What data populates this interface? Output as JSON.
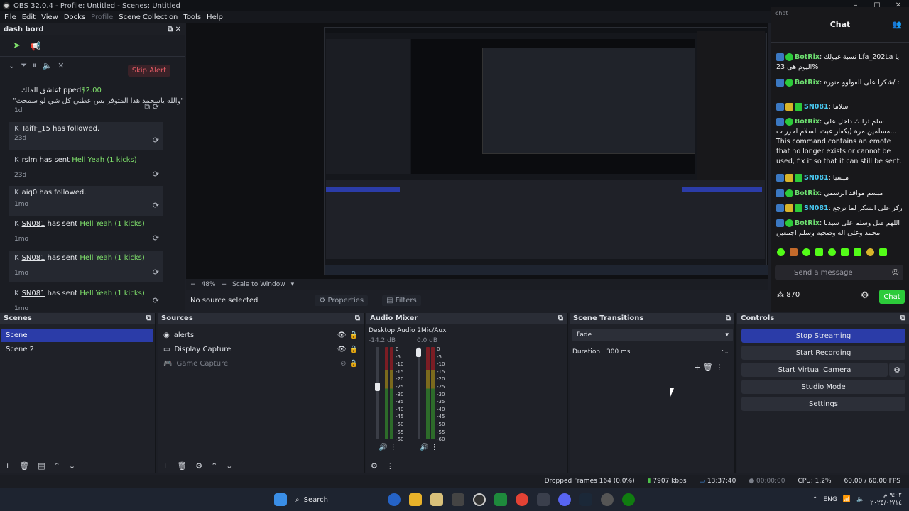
{
  "window": {
    "title": "OBS 32.0.4 - Profile: Untitled - Scenes: Untitled",
    "min": "–",
    "max": "□",
    "close": "✕"
  },
  "menu": [
    "File",
    "Edit",
    "View",
    "Docks",
    "Profile",
    "Scene Collection",
    "Tools",
    "Help"
  ],
  "dash": {
    "title": "dash bord",
    "skip": "Skip Alert",
    "events": [
      {
        "user": "عاشق الملك",
        "action": "tipped",
        "amount": "$2.00",
        "msg": "\"والله ياسحمد هذا المتوفر بس عطني كل شي لو سمحت\"",
        "time": "1d"
      },
      {
        "user": "TaifF_15",
        "action": "has followed.",
        "time": "23d"
      },
      {
        "user": "rslm",
        "action": "has sent",
        "gift": "Hell Yeah (1 kicks)",
        "time": "23d"
      },
      {
        "user": "aiq0",
        "action": "has followed.",
        "time": "1mo"
      },
      {
        "user": "SN081",
        "action": "has sent",
        "gift": "Hell Yeah (1 kicks)",
        "time": "1mo"
      },
      {
        "user": "SN081",
        "action": "has sent",
        "gift": "Hell Yeah (1 kicks)",
        "time": "1mo"
      },
      {
        "user": "SN081",
        "action": "has sent",
        "gift": "Hell Yeah (1 kicks)",
        "time": "1mo"
      }
    ]
  },
  "preview": {
    "zoom": "48%",
    "scale": "Scale to Window",
    "no_source": "No source selected",
    "properties": "Properties",
    "filters": "Filters"
  },
  "chat": {
    "small": "chat",
    "title": "Chat",
    "input_placeholder": "Send a message",
    "viewers": "870",
    "send": "Chat",
    "messages": [
      {
        "user": "BotRix",
        "text": "نسبة غيولك Lfa_202La يا %اليوم هي 23"
      },
      {
        "user": "BotRix",
        "text": "شكرا على الفولوو منورة/ :"
      },
      {
        "user": "SN081",
        "text": "سلاما"
      },
      {
        "user": "BotRix",
        "text": "سلم ثرالك داخل على مسلمين مرة (يكفار عبث السلام احرر ت... This command contains an emote that no longer exists or cannot be used, fix it so that it can still be sent."
      },
      {
        "user": "SN081",
        "text": "ميسيا"
      },
      {
        "user": "BotRix",
        "text": "مبسم مواقد الرسمي"
      },
      {
        "user": "SN081",
        "text": "ركز على الشكر لما ترجع"
      },
      {
        "user": "BotRix",
        "text": "اللهم صل وسلم على سيدنا محمد وعلى اله وصحبه وسلم اجمعين"
      }
    ]
  },
  "scenes": {
    "title": "Scenes",
    "items": [
      "Scene",
      "Scene 2"
    ]
  },
  "sources": {
    "title": "Sources",
    "items": [
      "alerts",
      "Display Capture",
      "Game Capture"
    ]
  },
  "mixer": {
    "title": "Audio Mixer",
    "channels": [
      {
        "name": "Desktop Audio 2",
        "db": "-14.2 dB"
      },
      {
        "name": "Mic/Aux",
        "db": "0.0 dB"
      }
    ],
    "scale": [
      "0",
      "-5",
      "-10",
      "-15",
      "-20",
      "-25",
      "-30",
      "-35",
      "-40",
      "-45",
      "-50",
      "-55",
      "-60"
    ]
  },
  "transitions": {
    "title": "Scene Transitions",
    "type": "Fade",
    "duration_label": "Duration",
    "duration": "300 ms"
  },
  "controls": {
    "title": "Controls",
    "buttons": [
      "Stop Streaming",
      "Start Recording",
      "Start Virtual Camera",
      "Studio Mode",
      "Settings"
    ]
  },
  "status": {
    "dropped": "Dropped Frames 164 (0.0%)",
    "kbps": "7907 kbps",
    "live": "13:37:40",
    "rec": "00:00:00",
    "cpu": "CPU: 1.2%",
    "fps": "60.00 / 60.00 FPS"
  },
  "taskbar": {
    "search": "Search",
    "lang": "ENG",
    "time": "٩:٠٢ م",
    "date": "٢٠٢٥/٠٢/١٤"
  },
  "colors": {
    "accent": "#2b3ca8",
    "kick_green": "#53fc18",
    "chat_btn": "#2ccb3a"
  }
}
